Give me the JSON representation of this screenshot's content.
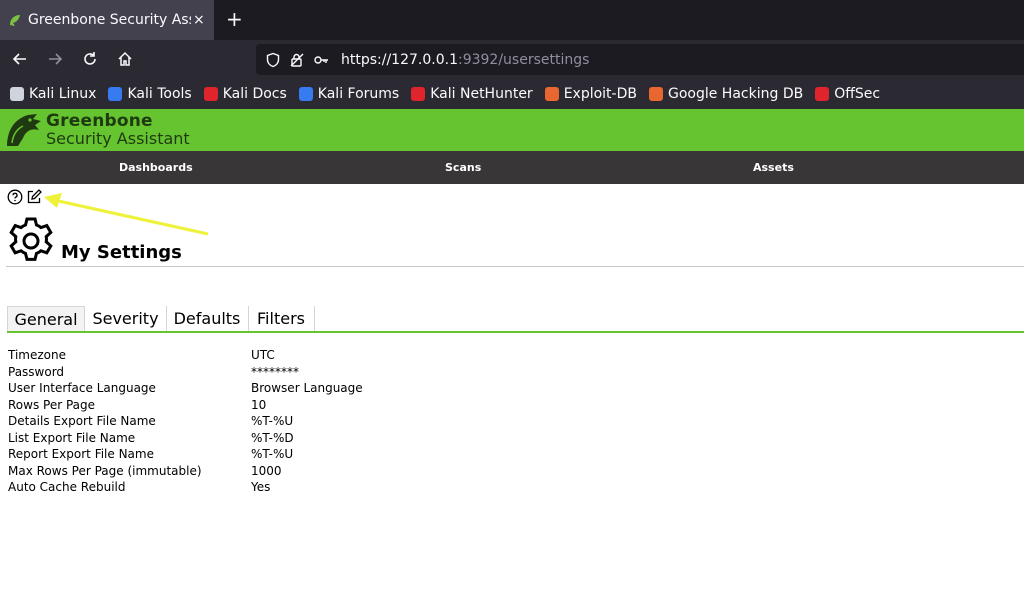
{
  "browser": {
    "tab_title": "Greenbone Security Assist",
    "tab_close": "×",
    "new_tab": "+",
    "url_host": "https://127.0.0.1",
    "url_rest": ":9392/usersettings",
    "bookmarks": [
      {
        "label": "Kali Linux",
        "icon": "kali-dragon-icon",
        "color": "#cfd4dc"
      },
      {
        "label": "Kali Tools",
        "icon": "kali-tools-icon",
        "color": "#367bf0"
      },
      {
        "label": "Kali Docs",
        "icon": "kali-docs-icon",
        "color": "#e0242d"
      },
      {
        "label": "Kali Forums",
        "icon": "kali-forums-icon",
        "color": "#367bf0"
      },
      {
        "label": "Kali NetHunter",
        "icon": "nethunter-icon",
        "color": "#e0242d"
      },
      {
        "label": "Exploit-DB",
        "icon": "exploit-db-icon",
        "color": "#e8662f"
      },
      {
        "label": "Google Hacking DB",
        "icon": "ghdb-icon",
        "color": "#e8662f"
      },
      {
        "label": "OffSec",
        "icon": "offsec-icon",
        "color": "#e0242d"
      }
    ]
  },
  "app": {
    "brand_line1": "Greenbone",
    "brand_line2": "Security Assistant",
    "accent": "#66c430",
    "menu": [
      "Dashboards",
      "Scans",
      "Assets"
    ]
  },
  "page": {
    "title": "My Settings",
    "tabs": [
      "General",
      "Severity",
      "Defaults",
      "Filters"
    ],
    "active_tab": "General",
    "settings": [
      {
        "key": "Timezone",
        "value": "UTC"
      },
      {
        "key": "Password",
        "value": "********"
      },
      {
        "key": "User Interface Language",
        "value": "Browser Language"
      },
      {
        "key": "Rows Per Page",
        "value": "10"
      },
      {
        "key": "Details Export File Name",
        "value": "%T-%U"
      },
      {
        "key": "List Export File Name",
        "value": "%T-%D"
      },
      {
        "key": "Report Export File Name",
        "value": "%T-%U"
      },
      {
        "key": "Max Rows Per Page (immutable)",
        "value": "1000"
      },
      {
        "key": "Auto Cache Rebuild",
        "value": "Yes"
      }
    ]
  }
}
